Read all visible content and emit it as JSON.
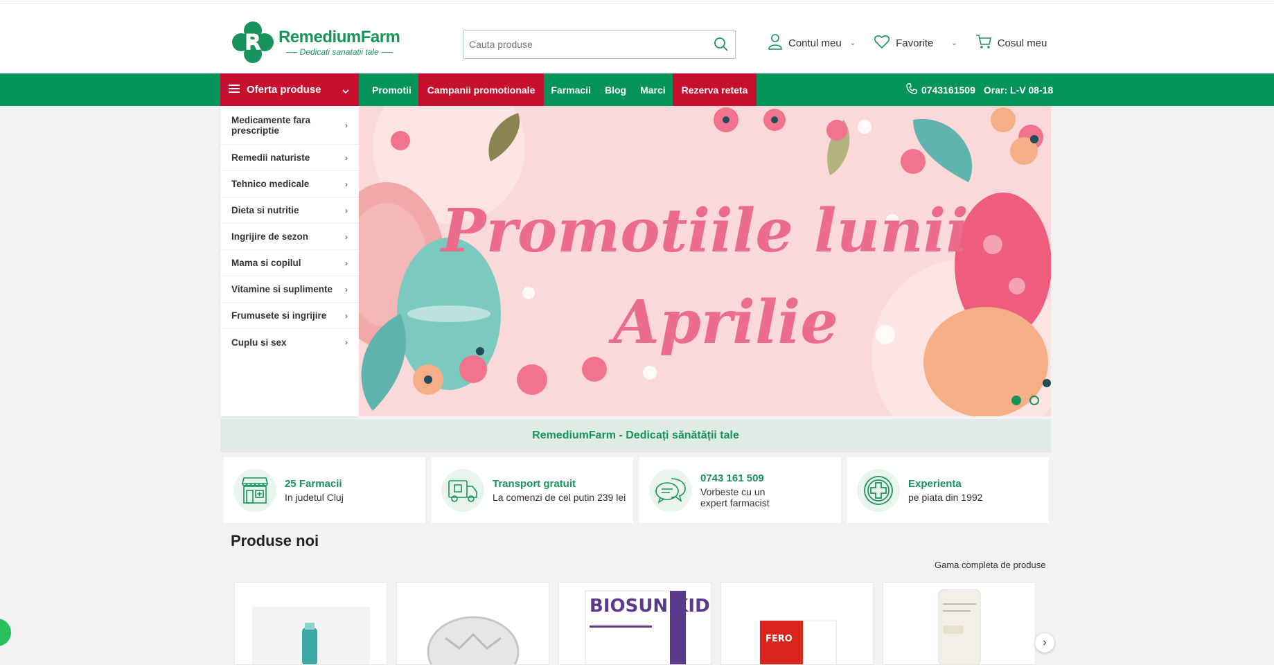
{
  "brand": {
    "name": "RemediumFarm",
    "tagline": "Dedicati sanatatii tale",
    "green": "#04945a",
    "red": "#c8102e"
  },
  "search": {
    "placeholder": "Cauta produse",
    "icon": "search-icon"
  },
  "header_actions": [
    {
      "label": "Contul meu",
      "icon": "user-icon"
    },
    {
      "label": "Favorite",
      "icon": "heart-icon"
    },
    {
      "label": "Cosul meu",
      "icon": "cart-icon"
    }
  ],
  "nav": {
    "offer_label": "Oferta produse",
    "links": [
      "Promotii",
      "Campanii promotionale",
      "Farmacii",
      "Blog",
      "Marci",
      "Rezerva reteta"
    ],
    "phone": "0743161509",
    "hours": "Orar: L-V 08-18"
  },
  "categories": [
    "Medicamente fara prescriptie",
    "Remedii naturiste",
    "Tehnico medicale",
    "Dieta si nutritie",
    "Ingrijire de sezon",
    "Mama si copilul",
    "Vitamine si suplimente",
    "Frumusete si ingrijire",
    "Cuplu si sex"
  ],
  "banner": {
    "line1": "Promotiile lunii",
    "line2": "Aprilie",
    "slides": 2,
    "active_slide": 1
  },
  "tagline_bar": "RemediumFarm - Dedicați sănătății tale",
  "features": [
    {
      "title": "25 Farmacii",
      "sub": "In judetul Cluj",
      "icon": "pharmacy-store-icon"
    },
    {
      "title": "Transport gratuit",
      "sub": "La comenzi de cel putin 239 lei",
      "icon": "delivery-truck-icon"
    },
    {
      "title": "0743 161 509",
      "sub": "Vorbeste cu un expert farmacist",
      "icon": "chat-bubbles-icon"
    },
    {
      "title": "Experienta",
      "sub": "pe piata din 1992",
      "icon": "medical-cross-icon"
    }
  ],
  "new_products": {
    "title": "Produse noi",
    "link": "Gama completa de produse",
    "items": [
      "BIOSUN KIDS",
      "FERO"
    ]
  }
}
